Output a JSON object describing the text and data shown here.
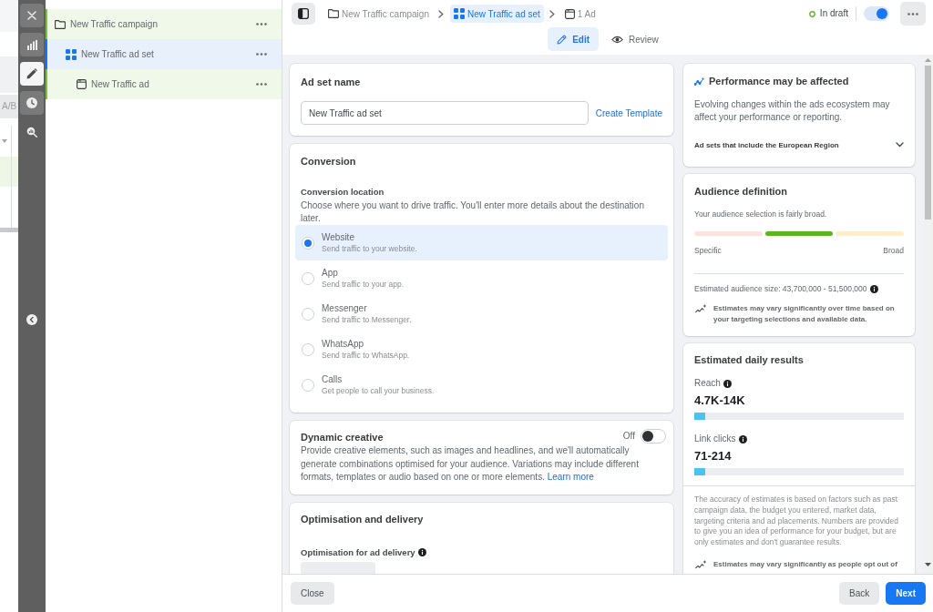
{
  "background_page": {
    "tab": "A/B"
  },
  "rail": {
    "items": [
      {
        "kind": "tile",
        "selected": false
      },
      {
        "kind": "tile",
        "selected": false
      },
      {
        "kind": "tile",
        "selected": true
      },
      {
        "kind": "tile",
        "selected": false
      },
      {
        "kind": "plain",
        "selected": false
      }
    ]
  },
  "tree": {
    "items": [
      {
        "label": "New Traffic campaign",
        "selected": false,
        "children": [
          {
            "label": "New Traffic ad set",
            "selected": true,
            "children": [
              {
                "label": "New Traffic ad",
                "selected": false
              }
            ]
          }
        ]
      }
    ]
  },
  "breadcrumbs": [
    {
      "label": "New Traffic campaign",
      "selected": false
    },
    {
      "label": "New Traffic ad set",
      "selected": true
    },
    {
      "label": "1 Ad",
      "selected": false
    }
  ],
  "draft_status": "In draft",
  "publish_toggle": {
    "on": true
  },
  "mode_tabs": [
    {
      "label": "Edit",
      "selected": true
    },
    {
      "label": "Review",
      "selected": false
    }
  ],
  "ad_set_name": {
    "title": "Ad set name",
    "value": "New Traffic ad set",
    "link": "Create Template"
  },
  "conversion": {
    "title": "Conversion",
    "field_label": "Conversion location",
    "description": "Choose where you want to drive traffic. You'll enter more details about the destination later.",
    "options": [
      {
        "label": "Website",
        "description": "Send traffic to your website.",
        "selected": true
      },
      {
        "label": "App",
        "description": "Send traffic to your app.",
        "selected": false
      },
      {
        "label": "Messenger",
        "description": "Send traffic to Messenger.",
        "selected": false
      },
      {
        "label": "WhatsApp",
        "description": "Send traffic to WhatsApp.",
        "selected": false
      },
      {
        "label": "Calls",
        "description": "Get people to call your business.",
        "selected": false
      }
    ]
  },
  "dynamic_creative": {
    "title": "Dynamic creative",
    "switch_label": "Off",
    "on": false,
    "description": "Provide creative elements, such as images and headlines, and we'll automatically generate combinations optimised for your audience. Variations may include different formats, templates or audio based on one or more elements.",
    "link": "Learn more"
  },
  "optimisation": {
    "title": "Optimisation and delivery",
    "field_label": "Optimisation for ad delivery"
  },
  "performance": {
    "title": "Performance may be affected",
    "body": "Evolving changes within the ads ecosystem may affect your performance or reporting.",
    "expander": "Ad sets that include the European Region",
    "expanded": false
  },
  "audience": {
    "title": "Audience definition",
    "summary": "Your audience selection is fairly broad.",
    "segments": [
      {
        "color": "#fce3e0"
      },
      {
        "color": "#5cb51f"
      },
      {
        "color": "#fdefcd"
      }
    ],
    "min_label": "Specific",
    "max_label": "Broad",
    "size": "Estimated audience size: 43,700,000 - 51,500,000",
    "note": "Estimates may vary significantly over time based on your targeting selections and available data."
  },
  "estimates": {
    "title": "Estimated daily results",
    "metrics": [
      {
        "label": "Reach",
        "value": "4.7K-14K",
        "level": 0.05
      },
      {
        "label": "Link clicks",
        "value": "71-214",
        "level": 0.05
      }
    ],
    "disclaimer": "The accuracy of estimates is based on factors such as past campaign data, the budget you entered, market data, targeting criteria and ad placements. Numbers are provided to give you an idea of performance for your budget, but are only estimates and don't guarantee results.",
    "note": "Estimates may vary significantly as people opt out of"
  },
  "footer": {
    "close": "Close",
    "back": "Back",
    "next": "Next"
  }
}
